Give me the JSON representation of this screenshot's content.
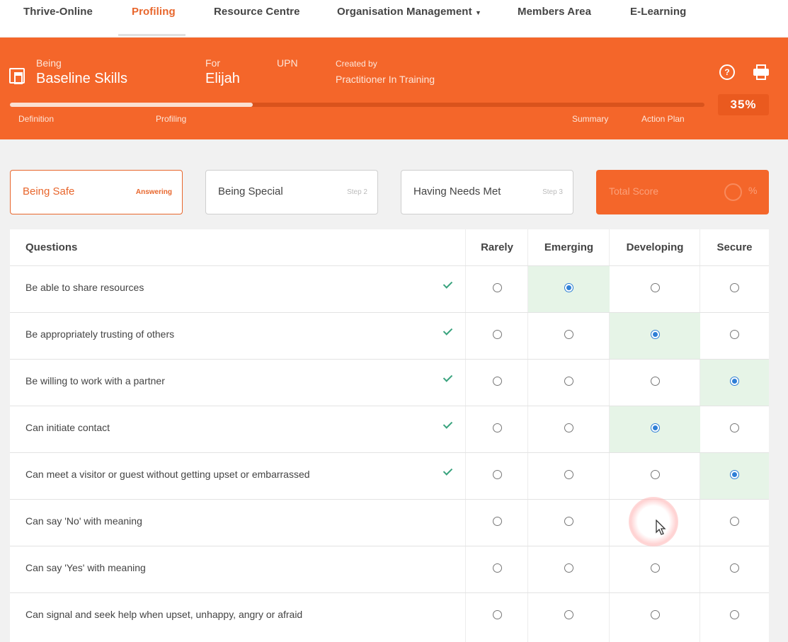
{
  "nav": {
    "items": [
      {
        "label": "Thrive-Online"
      },
      {
        "label": "Profiling"
      },
      {
        "label": "Resource Centre"
      },
      {
        "label": "Organisation Management"
      },
      {
        "label": "Members Area"
      },
      {
        "label": "E-Learning"
      }
    ],
    "active": "Profiling"
  },
  "header": {
    "being_label": "Being",
    "title": "Baseline Skills",
    "for_label": "For",
    "for_value": "Elijah",
    "upn_label": "UPN",
    "created_label": "Created by",
    "created_value": "Practitioner In Training",
    "stages": [
      "Definition",
      "Profiling",
      "Summary",
      "Action Plan"
    ],
    "progress_percent": 35,
    "percent_text": "35%"
  },
  "steps": [
    {
      "label": "Being Safe",
      "status": "Answering",
      "active": true
    },
    {
      "label": "Being Special",
      "status": "Step 2",
      "active": false
    },
    {
      "label": "Having Needs Met",
      "status": "Step 3",
      "active": false
    }
  ],
  "total": {
    "label": "Total Score",
    "unit": "%"
  },
  "table": {
    "headers": {
      "question": "Questions",
      "options": [
        "Rarely",
        "Emerging",
        "Developing",
        "Secure"
      ]
    },
    "rows": [
      {
        "q": "Be able to share resources",
        "answered": true,
        "selected": 1
      },
      {
        "q": "Be appropriately trusting of others",
        "answered": true,
        "selected": 2
      },
      {
        "q": "Be willing to work with a partner",
        "answered": true,
        "selected": 3
      },
      {
        "q": "Can initiate contact",
        "answered": true,
        "selected": 2
      },
      {
        "q": "Can meet a visitor or guest without getting upset or embarrassed",
        "answered": true,
        "selected": 3
      },
      {
        "q": "Can say 'No' with meaning",
        "answered": false,
        "selected": -1
      },
      {
        "q": "Can say 'Yes' with meaning",
        "answered": false,
        "selected": -1
      },
      {
        "q": "Can signal and seek help when upset, unhappy, angry or afraid",
        "answered": false,
        "selected": -1
      }
    ]
  },
  "colors": {
    "brand_orange": "#f4662a",
    "radio_selected": "#2f7fd6",
    "selected_cell": "#e6f4e7",
    "tick": "#3aa37e"
  }
}
